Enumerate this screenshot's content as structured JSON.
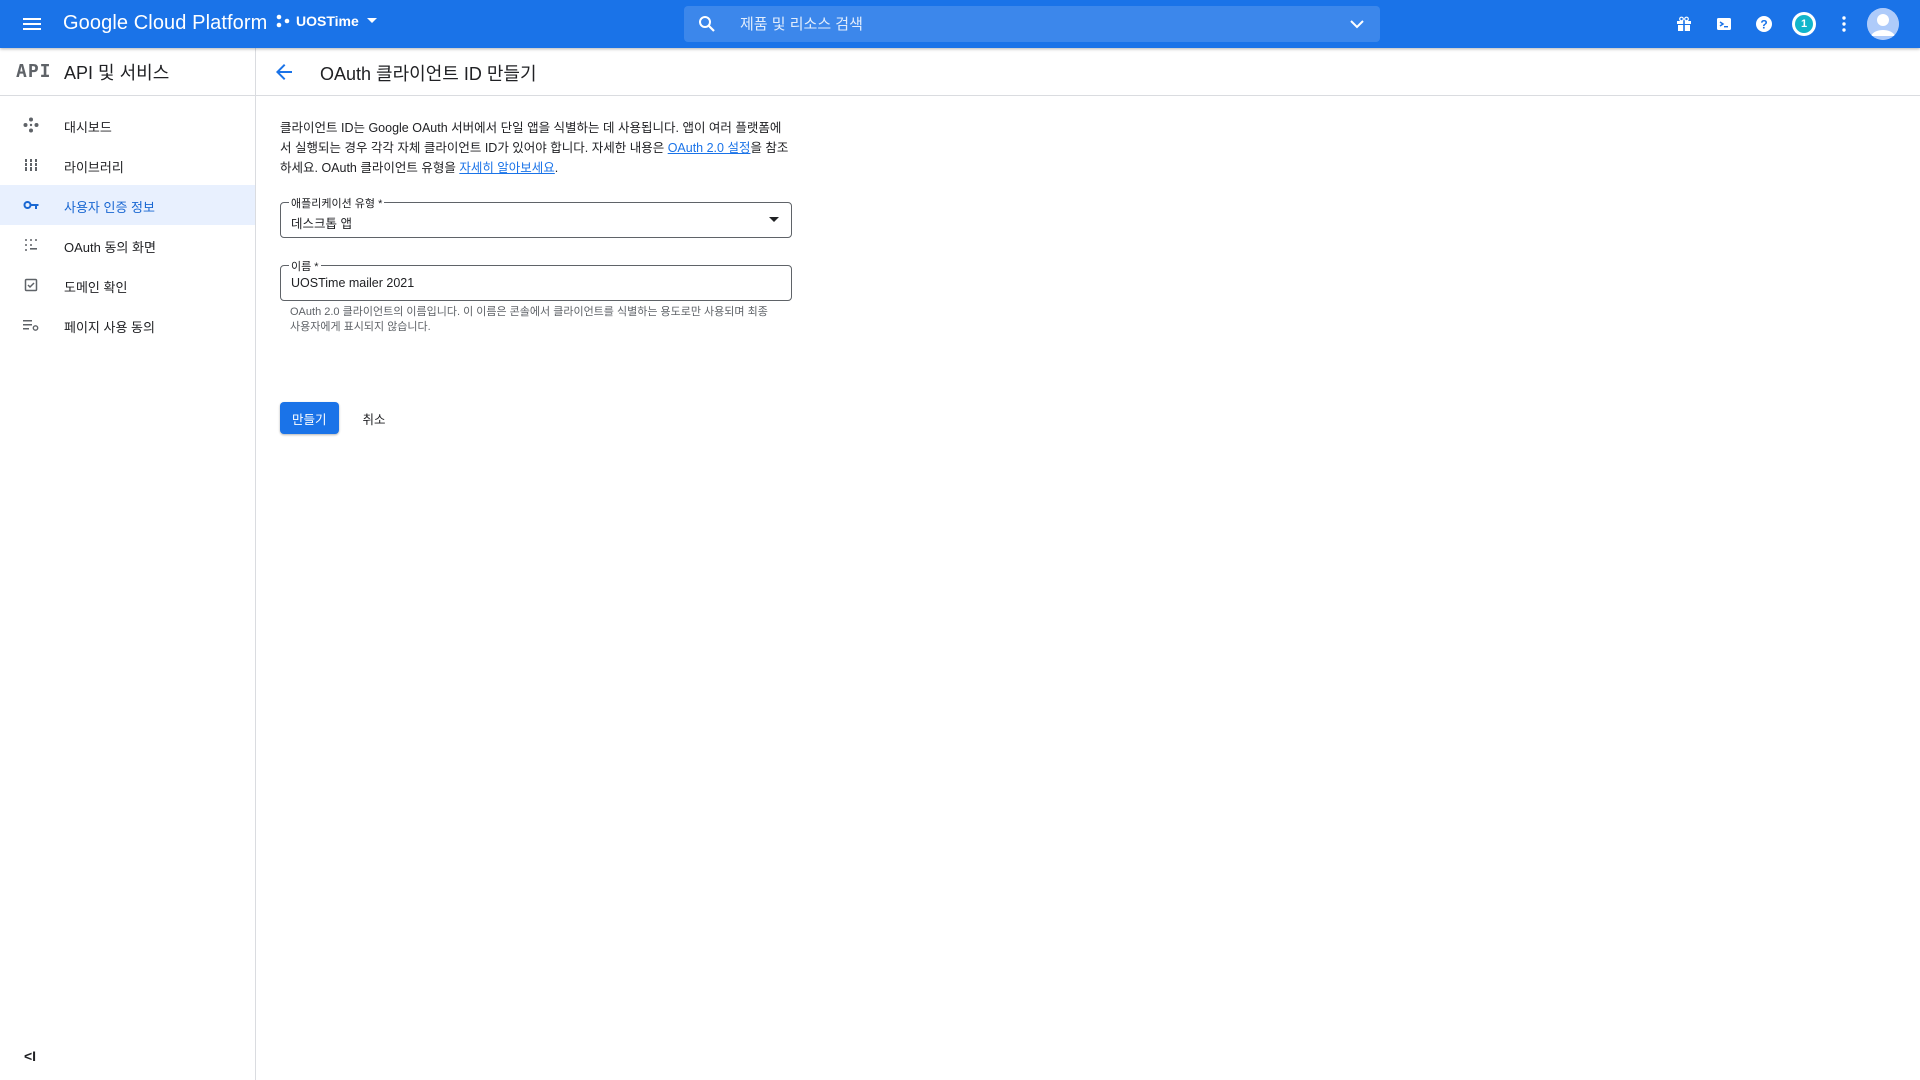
{
  "topbar": {
    "brand": "Google Cloud Platform",
    "project": "UOSTime",
    "search_placeholder": "제품 및 리소스 검색",
    "notification_count": "1",
    "color": "#1a73e8"
  },
  "sidebar": {
    "logo": "API",
    "title": "API 및 서비스",
    "items": [
      {
        "label": "대시보드",
        "icon": "dashboard-icon"
      },
      {
        "label": "라이브러리",
        "icon": "library-icon"
      },
      {
        "label": "사용자 인증 정보",
        "icon": "key-icon",
        "active": true
      },
      {
        "label": "OAuth 동의 화면",
        "icon": "consent-icon"
      },
      {
        "label": "도메인 확인",
        "icon": "checkbox-icon"
      },
      {
        "label": "페이지 사용 동의",
        "icon": "settings-list-icon"
      }
    ],
    "collapse": "<I"
  },
  "page": {
    "title": "OAuth 클라이언트 ID 만들기",
    "intro_1": "클라이언트 ID는 Google OAuth 서버에서 단일 앱을 식별하는 데 사용됩니다. 앱이 여러 플랫폼에서 실행되는 경우 각각 자체 클라이언트 ID가 있어야 합니다. 자세한 내용은 ",
    "intro_link1": "OAuth 2.0 설정",
    "intro_2": "을 참조하세요. OAuth 클라이언트 유형을 ",
    "intro_link2": "자세히 알아보세요",
    "intro_3": ".",
    "app_type_label": "애플리케이션 유형 *",
    "app_type_value": "데스크톱 앱",
    "name_label": "이름 *",
    "name_value": "UOSTime mailer 2021",
    "name_hint": "OAuth 2.0 클라이언트의 이름입니다. 이 이름은 콘솔에서 클라이언트를 식별하는 용도로만 사용되며 최종 사용자에게 표시되지 않습니다.",
    "create_button": "만들기",
    "cancel_button": "취소"
  }
}
